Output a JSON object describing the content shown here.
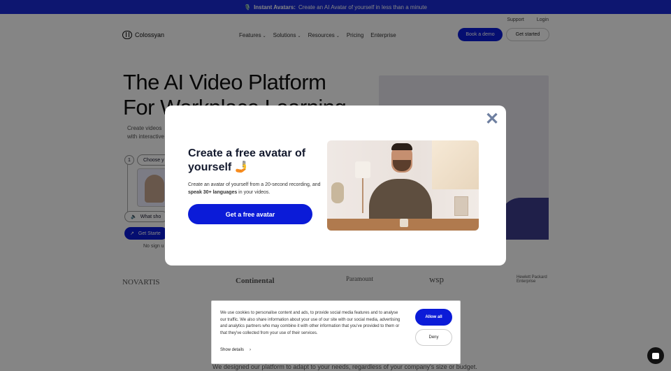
{
  "announcement": {
    "emoji": "🎙️",
    "bold": "Instant Avatars:",
    "text": "Create an AI Avatar of yourself in less than a minute"
  },
  "topbar": {
    "support": "Support",
    "login": "Login"
  },
  "nav": {
    "logo": "Colossyan",
    "menu": [
      {
        "label": "Features",
        "caret": "⌄"
      },
      {
        "label": "Solutions",
        "caret": "⌄"
      },
      {
        "label": "Resources",
        "caret": "⌄"
      },
      {
        "label": "Pricing",
        "caret": ""
      },
      {
        "label": "Enterprise",
        "caret": ""
      }
    ],
    "book_demo": "Book a demo",
    "get_started": "Get started"
  },
  "hero": {
    "title_line1": "The AI Video Platform",
    "title_line2": "For Workplace Learning",
    "subtitle": "Create videos with interactive",
    "step_number": "1",
    "step_label": "Choose y",
    "what_label": "What sho",
    "get_started": "Get Starte",
    "no_signup": "No sign u"
  },
  "logos": [
    "NOVARTIS",
    "Continental",
    "Paramount",
    "wsp",
    "Hewlett Packard Enterprise"
  ],
  "below_text": "We designed our platform to adapt to your needs, regardless of your company's size or budget.",
  "modal": {
    "close": "✕",
    "title": "Create a free avatar of yourself 🤳",
    "body_1": "Create an avatar of yourself from a 20-second recording, and ",
    "body_bold": "speak 30+ languages",
    "body_2": " in your videos.",
    "cta": "Get a free avatar"
  },
  "cookie": {
    "text": "We use cookies to personalise content and ads, to provide social media features and to analyse our traffic. We also share information about your use of our site with our social media, advertising and analytics partners who may combine it with other information that you've provided to them or that they've collected from your use of their services.",
    "details": "Show details",
    "details_caret": "›",
    "allow": "Allow all",
    "deny": "Deny"
  },
  "colors": {
    "accent": "#0b1bd8",
    "announce_bg": "#1a2bd6",
    "close_icon": "#6e7fa0"
  }
}
